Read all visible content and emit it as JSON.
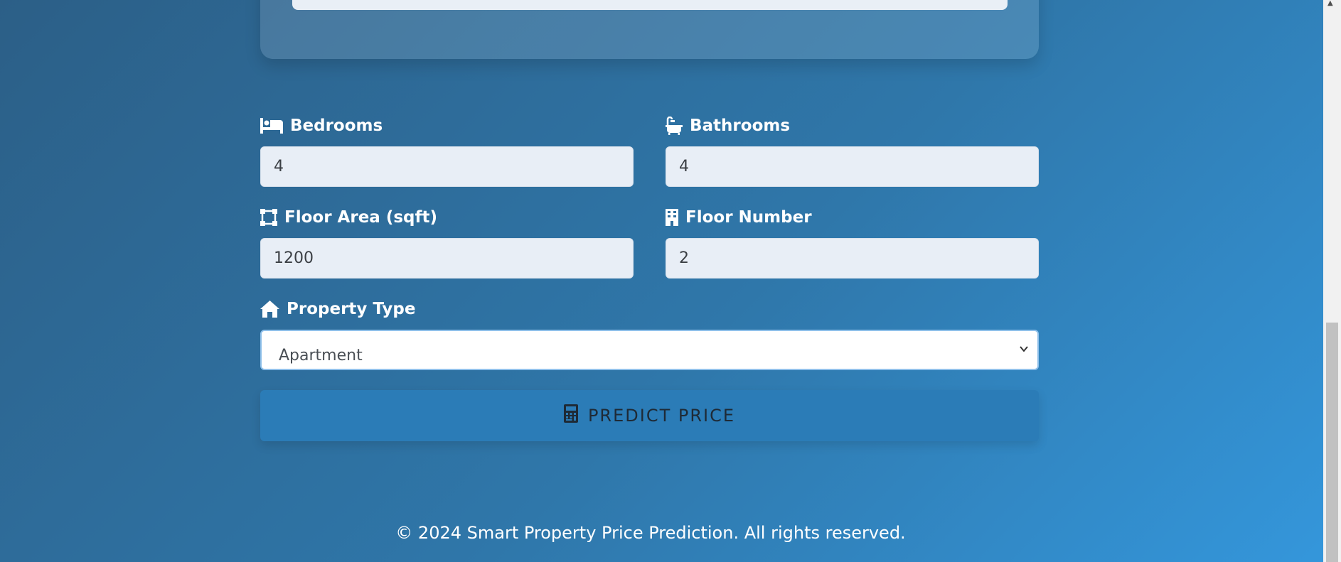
{
  "fields": {
    "bedrooms": {
      "label": "Bedrooms",
      "value": "4",
      "icon": "bed-icon"
    },
    "bathrooms": {
      "label": "Bathrooms",
      "value": "4",
      "icon": "bath-icon"
    },
    "floor_area": {
      "label": "Floor Area (sqft)",
      "value": "1200",
      "icon": "area-icon"
    },
    "floor_number": {
      "label": "Floor Number",
      "value": "2",
      "icon": "building-icon"
    },
    "property_type": {
      "label": "Property Type",
      "selected": "Apartment",
      "icon": "home-icon"
    }
  },
  "predict_button": {
    "label": "PREDICT PRICE",
    "icon": "calculator-icon"
  },
  "footer": {
    "text": "© 2024 Smart Property Price Prediction. All rights reserved."
  },
  "colors": {
    "background_start": "#2c5f87",
    "background_end": "#3497dc",
    "button": "#2b7cb7",
    "input_bg": "#e8eef6"
  }
}
